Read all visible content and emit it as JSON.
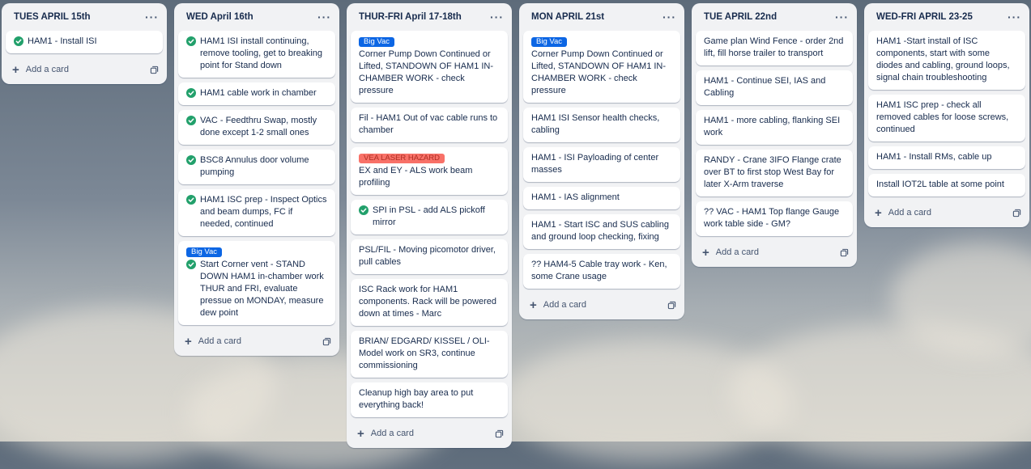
{
  "lists": [
    {
      "title": "TUES APRIL 15th",
      "cards": [
        {
          "text": "HAM1 - Install ISI",
          "done": true
        }
      ]
    },
    {
      "title": "WED April 16th",
      "cards": [
        {
          "text": "HAM1 ISI install continuing, remove tooling, get to breaking point for Stand down",
          "done": true
        },
        {
          "text": "HAM1 cable work in chamber",
          "done": true
        },
        {
          "text": "VAC - Feedthru Swap, mostly done except 1-2 small ones",
          "done": true
        },
        {
          "text": "BSC8 Annulus door volume pumping",
          "done": true
        },
        {
          "text": "HAM1 ISC prep - Inspect Optics and beam dumps, FC if needed, continued",
          "done": true
        },
        {
          "label": "Big Vac",
          "labelColor": "blue",
          "text": "Start Corner vent - STAND DOWN HAM1 in-chamber work THUR and FRI, evaluate pressue on MONDAY, measure dew point",
          "done": true
        }
      ]
    },
    {
      "title": "THUR-FRI April 17-18th",
      "cards": [
        {
          "label": "Big Vac",
          "labelColor": "blue",
          "text": "Corner Pump Down Continued or Lifted, STANDOWN OF HAM1 IN-CHAMBER WORK - check pressure"
        },
        {
          "text": "Fil - HAM1 Out of vac cable runs to chamber"
        },
        {
          "label": "VEA LASER HAZARD",
          "labelColor": "red",
          "text": "EX and EY - ALS work beam profiling"
        },
        {
          "text": "SPI in PSL - add ALS pickoff mirror",
          "done": true
        },
        {
          "text": "PSL/FIL - Moving picomotor driver, pull cables"
        },
        {
          "text": "ISC Rack work for HAM1 components. Rack will be powered down at times - Marc"
        },
        {
          "text": "BRIAN/ EDGARD/ KISSEL / OLI- Model work on SR3, continue commissioning"
        },
        {
          "text": "Cleanup high bay area to put everything back!"
        }
      ]
    },
    {
      "title": "MON APRIL 21st",
      "cards": [
        {
          "label": "Big Vac",
          "labelColor": "blue",
          "text": "Corner Pump Down Continued or Lifted, STANDOWN OF HAM1 IN-CHAMBER WORK - check pressure"
        },
        {
          "text": "HAM1 ISI Sensor health checks, cabling"
        },
        {
          "text": "HAM1 - ISI Payloading of center masses"
        },
        {
          "text": "HAM1 - IAS alignment"
        },
        {
          "text": "HAM1 - Start ISC and SUS cabling and ground loop checking, fixing"
        },
        {
          "text": "?? HAM4-5 Cable tray work - Ken, some Crane usage"
        }
      ]
    },
    {
      "title": "TUE APRIL 22nd",
      "cards": [
        {
          "text": "Game plan Wind Fence - order 2nd lift, fill horse trailer to transport"
        },
        {
          "text": "HAM1 - Continue SEI, IAS and Cabling"
        },
        {
          "text": "HAM1 - more cabling, flanking SEI work"
        },
        {
          "text": "RANDY - Crane 3IFO Flange crate over BT to first stop West Bay for later X-Arm traverse"
        },
        {
          "text": "?? VAC - HAM1 Top flange Gauge work table side - GM?"
        }
      ]
    },
    {
      "title": "WED-FRI APRIL 23-25",
      "cards": [
        {
          "text": "HAM1 -Start install of ISC components, start with some diodes and cabling, ground loops, signal chain troubleshooting"
        },
        {
          "text": "HAM1 ISC prep - check all removed cables for loose screws, continued"
        },
        {
          "text": "HAM1 - Install RMs, cable up"
        },
        {
          "text": "Install IOT2L table at some point"
        }
      ]
    }
  ],
  "ui": {
    "add_card_label": "Add a card",
    "menu_glyph": "···",
    "plus_glyph": "+"
  }
}
